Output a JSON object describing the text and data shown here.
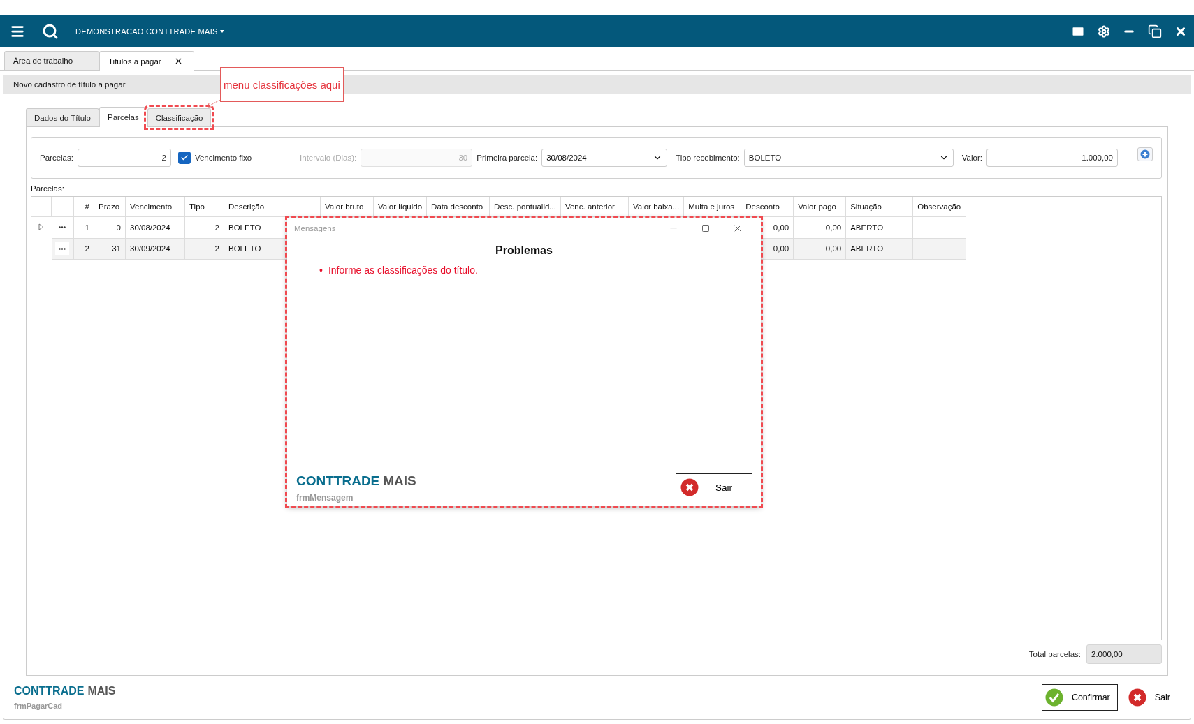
{
  "app_bar": {
    "company": "DEMONSTRACAO CONTTRADE MAIS"
  },
  "doc_tabs": [
    {
      "label": "Área de trabalho",
      "selected": false,
      "closable": false
    },
    {
      "label": "Titulos a pagar",
      "selected": true,
      "closable": true
    }
  ],
  "form": {
    "title": "Novo cadastro de título a pagar",
    "tabs": [
      {
        "label": "Dados do Título",
        "selected": false,
        "highlighted": false
      },
      {
        "label": "Parcelas",
        "selected": true,
        "highlighted": false
      },
      {
        "label": "Classificação",
        "selected": false,
        "highlighted": true
      }
    ],
    "parcelas": {
      "label": "Parcelas:",
      "value": "2"
    },
    "vencimento_fixo": {
      "label": "Vencimento fixo",
      "checked": true
    },
    "intervalo": {
      "label": "Intervalo (Dias):",
      "value": "30",
      "disabled": true
    },
    "primeira_parcela": {
      "label": "Primeira parcela:",
      "value": "30/08/2024"
    },
    "tipo_recebimento": {
      "label": "Tipo recebimento:",
      "value": "BOLETO"
    },
    "valor": {
      "label": "Valor:",
      "value": "1.000,00"
    },
    "table_label": "Parcelas:",
    "table": {
      "columns": [
        "#",
        "Prazo",
        "Vencimento",
        "Tipo",
        "Descrição",
        "Valor bruto",
        "Valor líquido",
        "Data desconto",
        "Desc. pontualid...",
        "Venc. anterior",
        "Valor baixa...",
        "Multa e juros",
        "Desconto",
        "Valor pago",
        "Situação",
        "Observação"
      ],
      "rows": [
        {
          "current": true,
          "lead": [
            "1",
            "0",
            "30/08/2024",
            "2",
            "BOLETO"
          ],
          "tail": [
            "0,00",
            "0,00",
            "ABERTO"
          ]
        },
        {
          "current": false,
          "lead": [
            "2",
            "31",
            "30/09/2024",
            "2",
            "BOLETO"
          ],
          "tail": [
            "0,00",
            "0,00",
            "ABERTO"
          ]
        }
      ]
    },
    "total": {
      "label": "Total parcelas:",
      "value": "2.000,00"
    },
    "brand": {
      "primary": "CONTTRADE",
      "secondary": "MAIS",
      "form_name": "frmPagarCad"
    },
    "buttons": [
      {
        "kind": "confirm",
        "label": "Confirmar",
        "focused": true
      },
      {
        "kind": "cancel",
        "label": "Sair",
        "focused": false
      }
    ]
  },
  "annotation": {
    "text": "menu classificações aqui"
  },
  "dialog": {
    "title": "Mensagens",
    "highlighted": true,
    "heading": "Problemas",
    "bullet": "•",
    "messages": [
      "Informe as classificações do título."
    ],
    "brand": {
      "primary": "CONTTRADE",
      "secondary": "MAIS",
      "form_name": "frmMensagem"
    },
    "button": {
      "kind": "cancel",
      "label": "Sair",
      "focused": true
    }
  }
}
